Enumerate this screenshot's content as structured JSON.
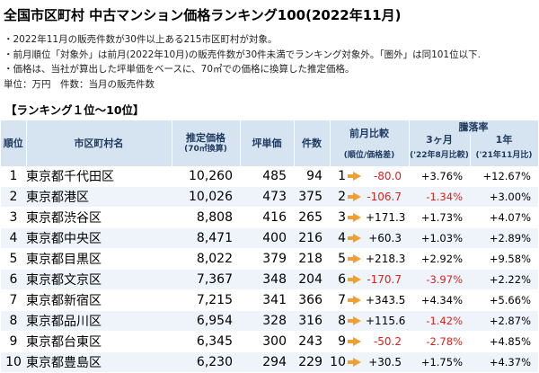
{
  "title": "全国市区町村 中古マンション価格ランキング100(2022年11月)",
  "notes": [
    "・2022年11月の販売件数が30件以上ある215市区町村が対象。",
    "・前月順位「対象外」は前月(2022年10月)の販売件数が30件未満でランキング対象外。「圏外」は同101位以下.",
    "・価格は、当社が算出した坪単価をベースに、70㎡での価格に換算した推定価格。",
    "単位：万円　件数：当月の販売件数"
  ],
  "section_title": "【ランキング１位～10位】",
  "headers": {
    "rank": "順位",
    "city": "市区町村名",
    "price": "推定価格",
    "price_sub": "(70㎡換算)",
    "tsubo": "坪単価",
    "count": "件数",
    "prev": "前月比較",
    "prev_sub": "(順位/価格差)",
    "rate": "騰落率",
    "three_month": "3ヶ月",
    "three_month_sub": "('22年8月比較)",
    "one_year": "1年",
    "one_year_sub": "('21年11月比)"
  },
  "rows": [
    {
      "rank": "1",
      "city": "東京都千代田区",
      "price": "10,260",
      "tsubo": "485",
      "count": "94",
      "prev_rank": "1",
      "diff": "-80.0",
      "diff_neg": true,
      "m3": "+3.76%",
      "m3_neg": false,
      "y1": "+12.67%",
      "y1_neg": false
    },
    {
      "rank": "2",
      "city": "東京都港区",
      "price": "10,026",
      "tsubo": "473",
      "count": "375",
      "prev_rank": "2",
      "diff": "-106.7",
      "diff_neg": true,
      "m3": "-1.34%",
      "m3_neg": true,
      "y1": "+3.00%",
      "y1_neg": false
    },
    {
      "rank": "3",
      "city": "東京都渋谷区",
      "price": "8,808",
      "tsubo": "416",
      "count": "265",
      "prev_rank": "3",
      "diff": "+171.3",
      "diff_neg": false,
      "m3": "+1.73%",
      "m3_neg": false,
      "y1": "+4.07%",
      "y1_neg": false
    },
    {
      "rank": "4",
      "city": "東京都中央区",
      "price": "8,471",
      "tsubo": "400",
      "count": "216",
      "prev_rank": "4",
      "diff": "+60.3",
      "diff_neg": false,
      "m3": "+1.03%",
      "m3_neg": false,
      "y1": "+2.89%",
      "y1_neg": false
    },
    {
      "rank": "5",
      "city": "東京都目黒区",
      "price": "8,022",
      "tsubo": "379",
      "count": "218",
      "prev_rank": "5",
      "diff": "+218.3",
      "diff_neg": false,
      "m3": "+2.92%",
      "m3_neg": false,
      "y1": "+9.58%",
      "y1_neg": false
    },
    {
      "rank": "6",
      "city": "東京都文京区",
      "price": "7,367",
      "tsubo": "348",
      "count": "204",
      "prev_rank": "6",
      "diff": "-170.7",
      "diff_neg": true,
      "m3": "-3.97%",
      "m3_neg": true,
      "y1": "+2.22%",
      "y1_neg": false
    },
    {
      "rank": "7",
      "city": "東京都新宿区",
      "price": "7,215",
      "tsubo": "341",
      "count": "366",
      "prev_rank": "7",
      "diff": "+343.5",
      "diff_neg": false,
      "m3": "+4.34%",
      "m3_neg": false,
      "y1": "+5.66%",
      "y1_neg": false
    },
    {
      "rank": "8",
      "city": "東京都品川区",
      "price": "6,954",
      "tsubo": "328",
      "count": "316",
      "prev_rank": "8",
      "diff": "+115.6",
      "diff_neg": false,
      "m3": "-1.42%",
      "m3_neg": true,
      "y1": "+2.87%",
      "y1_neg": false
    },
    {
      "rank": "9",
      "city": "東京都台東区",
      "price": "6,345",
      "tsubo": "300",
      "count": "243",
      "prev_rank": "9",
      "diff": "-50.2",
      "diff_neg": true,
      "m3": "-2.78%",
      "m3_neg": true,
      "y1": "+4.85%",
      "y1_neg": false
    },
    {
      "rank": "10",
      "city": "東京都豊島区",
      "price": "6,230",
      "tsubo": "294",
      "count": "229",
      "prev_rank": "10",
      "diff": "+30.5",
      "diff_neg": false,
      "m3": "+1.75%",
      "m3_neg": false,
      "y1": "+4.37%",
      "y1_neg": false
    }
  ],
  "colors": {
    "header_bg": "#d6e4f2",
    "stripe_bg": "#eef4fa",
    "negative": "#e0201a",
    "arrow": "#f0a030"
  }
}
